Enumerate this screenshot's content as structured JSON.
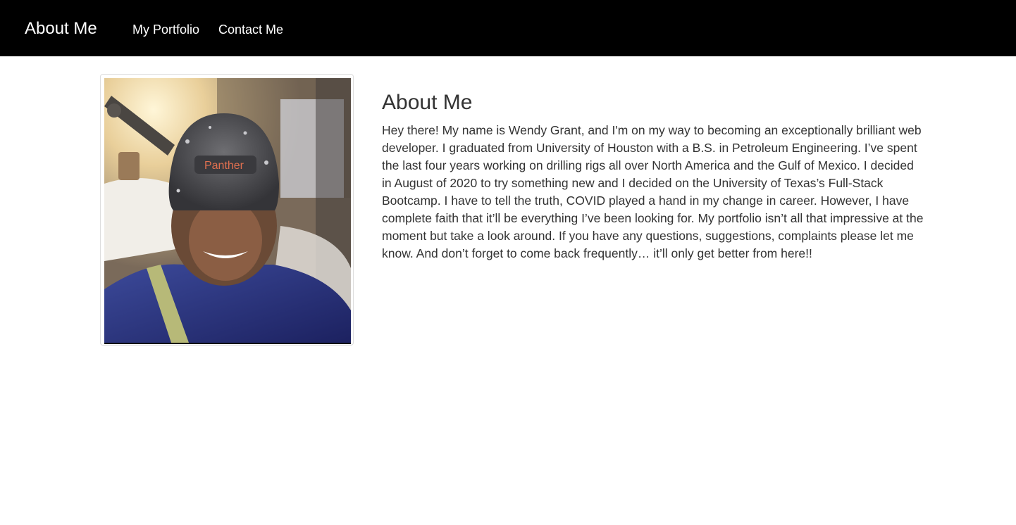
{
  "navbar": {
    "brand": "About Me",
    "links": [
      "My Portfolio",
      "Contact Me"
    ],
    "background": "#000000"
  },
  "profile_photo": {
    "cap_text": "Panther"
  },
  "main": {
    "heading": "About Me",
    "bio": "Hey there! My name is Wendy Grant, and I'm on my way to becoming an exceptionally brilliant web developer. I graduated from University of Houston with a B.S. in Petroleum Engineering. I’ve spent the last four years working on drilling rigs all over North America and the Gulf of Mexico. I decided in August of 2020 to try something new and I decided on the University of Texas’s Full-Stack Bootcamp. I have to tell the truth, COVID played a hand in my change in career. However, I have complete faith that it’ll be everything I’ve been looking for. My portfolio isn’t all that impressive at the moment but take a look around. If you have any questions, suggestions, complaints please let me know. And don’t forget to come back frequently… it’ll only get better from here!!"
  }
}
